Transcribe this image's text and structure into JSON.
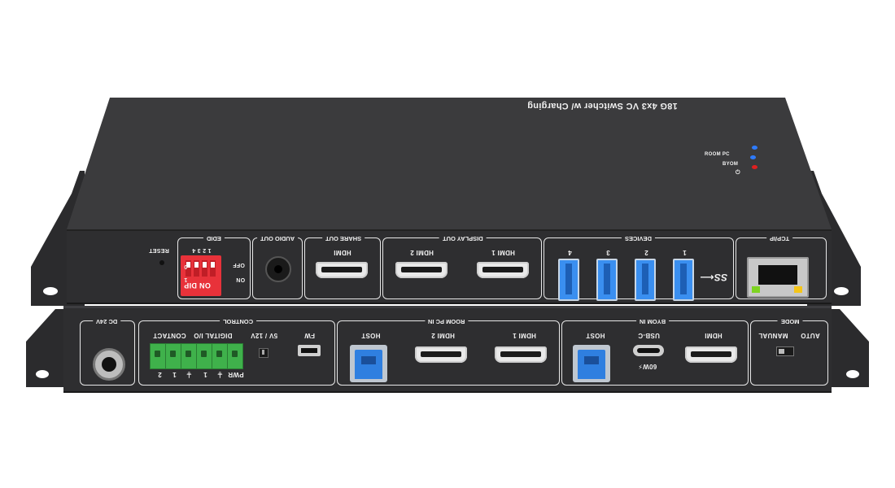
{
  "device": {
    "title": "18G 4x3 VC Switcher w/ Charging",
    "leds": [
      "ROOM PC",
      "BYOM",
      "⏻"
    ]
  },
  "top_panel": {
    "reset": "RESET",
    "edid": {
      "title": "EDID",
      "dip_numbers": "1 2 3 4",
      "on_dip": "ON DIP",
      "off": "OFF",
      "on": "ON",
      "zero": "0",
      "one": "1"
    },
    "audio_out": {
      "title": "AUDIO OUT"
    },
    "share_out": {
      "title": "SHARE OUT",
      "port": "HDMI"
    },
    "display_out": {
      "title": "DISPLAY OUT",
      "ports": [
        "HDMI 2",
        "HDMI 1"
      ]
    },
    "devices": {
      "title": "DEVICES",
      "ports": [
        "4",
        "3",
        "2",
        "1"
      ],
      "ss_logo": "SS⟵"
    },
    "tcpip": {
      "title": "TCP/IP"
    }
  },
  "bottom_panel": {
    "dc": "DC 24V",
    "control": {
      "title": "CONTROL",
      "contact": "CONTACT",
      "digital_io": "DIGITAL I/O",
      "voltage": "5V / 12V",
      "fw": "FW",
      "pins": [
        "2",
        "1",
        "⏚",
        "1",
        "⏚",
        "PWR"
      ]
    },
    "room_pc_in": {
      "title": "ROOM PC IN",
      "ports": [
        "HOST",
        "HDMI 2",
        "HDMI 1"
      ]
    },
    "byom_in": {
      "title": "BYOM IN",
      "ports": [
        "HOST",
        "USB-C",
        "HDMI"
      ],
      "power": "60W⚡"
    },
    "mode": {
      "title": "MODE",
      "auto": "AUTO",
      "manual": "MANUAL"
    }
  }
}
